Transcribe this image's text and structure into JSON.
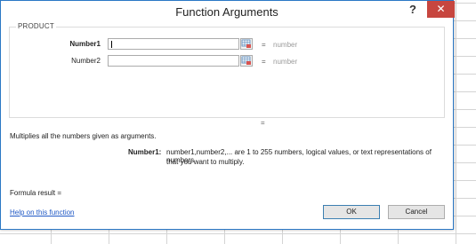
{
  "dialog": {
    "title": "Function Arguments",
    "help_glyph": "?",
    "close_glyph": "✕"
  },
  "function": {
    "name": "PRODUCT",
    "args": [
      {
        "label": "Number1",
        "bold": true,
        "value": "",
        "result": "number"
      },
      {
        "label": "Number2",
        "bold": false,
        "value": "",
        "result": "number"
      }
    ],
    "equals": "=",
    "result_sign": "="
  },
  "description": "Multiplies all the numbers given as arguments.",
  "arg_help": {
    "label": "Number1:",
    "text_line1": "number1,number2,... are 1 to 255 numbers, logical values, or text representations of numbers",
    "text_line2": "that you want to multiply."
  },
  "formula_result": "Formula result =",
  "help_link": "Help on this function",
  "buttons": {
    "ok": "OK",
    "cancel": "Cancel"
  },
  "colors": {
    "accent_border": "#2b78c5",
    "close_bg": "#c7463f",
    "link": "#1f58c5"
  }
}
